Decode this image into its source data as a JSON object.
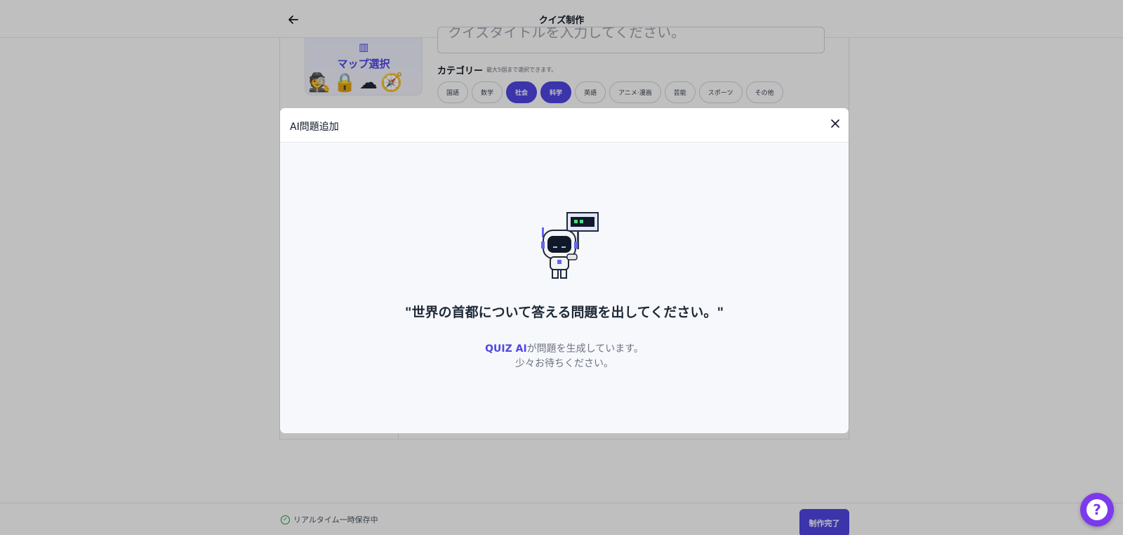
{
  "header": {
    "title": "クイズ制作"
  },
  "editor": {
    "map_label": "マップ選択",
    "title_placeholder": "クイズタイトルを入力してください。",
    "category_label": "カテゴリー",
    "category_hint": "最大5個まで選択できます。",
    "categories": [
      {
        "label": "国語",
        "selected": false
      },
      {
        "label": "数学",
        "selected": false
      },
      {
        "label": "社会",
        "selected": true
      },
      {
        "label": "科学",
        "selected": true
      },
      {
        "label": "英語",
        "selected": false
      },
      {
        "label": "アニメ·漫画",
        "selected": false
      },
      {
        "label": "芸能",
        "selected": false
      },
      {
        "label": "スポーツ",
        "selected": false
      },
      {
        "label": "その他",
        "selected": false
      }
    ]
  },
  "footer": {
    "save_status": "リアルタイム一時保存中",
    "finish_label": "制作完了"
  },
  "modal": {
    "title": "AI問題追加",
    "prompt": "\"世界の首都について答える問題を出してください。\"",
    "brand": "QUIZ AI",
    "status_suffix": "が問題を生成しています。",
    "status_line2": "少々お待ちください。"
  },
  "icons": {
    "back": "arrow-left-icon",
    "close": "close-icon",
    "check": "check-circle-icon",
    "help": "question-icon",
    "map": "map-icon",
    "robot": "robot-illustration"
  },
  "colors": {
    "accent": "#4f46e5",
    "help_fab": "#7c3aed",
    "success": "#16a34a"
  }
}
